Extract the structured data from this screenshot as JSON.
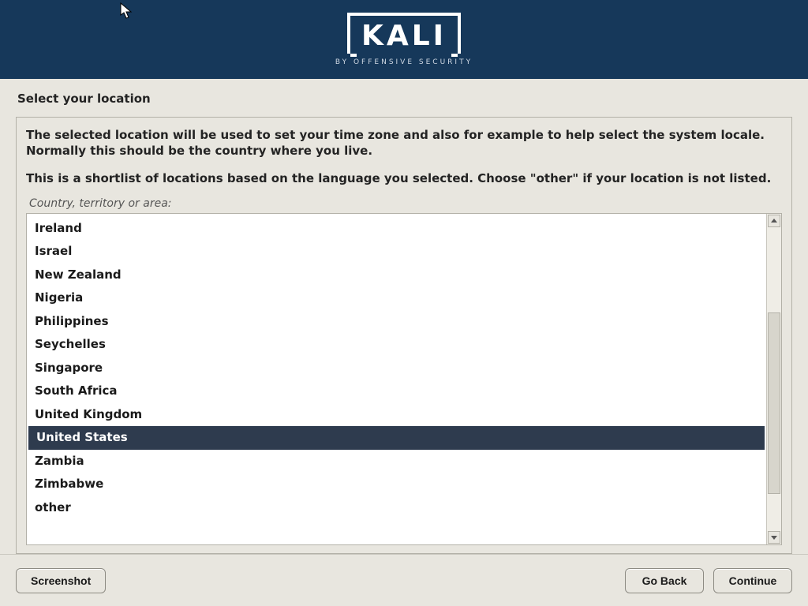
{
  "brand": {
    "name": "KALI",
    "tagline": "BY OFFENSIVE SECURITY"
  },
  "page": {
    "title": "Select your location",
    "desc1": "The selected location will be used to set your time zone and also for example to help select the system locale. Normally this should be the country where you live.",
    "desc2": "This is a shortlist of locations based on the language you selected. Choose \"other\" if your location is not listed.",
    "list_label": "Country, territory or area:"
  },
  "locations": [
    "Ireland",
    "Israel",
    "New Zealand",
    "Nigeria",
    "Philippines",
    "Seychelles",
    "Singapore",
    "South Africa",
    "United Kingdom",
    "United States",
    "Zambia",
    "Zimbabwe",
    "other"
  ],
  "selected_location": "United States",
  "footer": {
    "screenshot": "Screenshot",
    "go_back": "Go Back",
    "continue": "Continue"
  }
}
